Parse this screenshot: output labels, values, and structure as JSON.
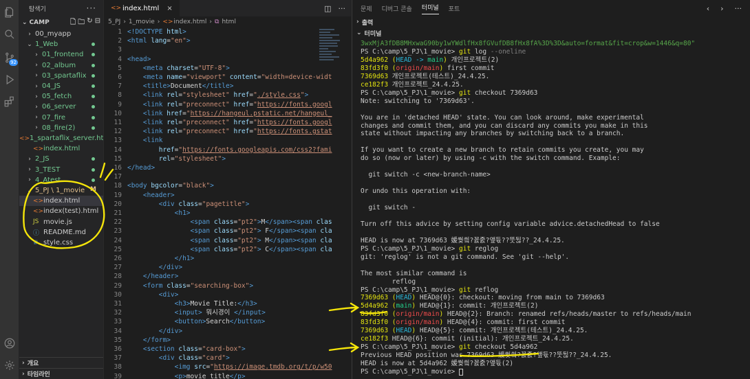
{
  "explorer": {
    "title": "탐색기",
    "root": "CAMP",
    "items": [
      {
        "label": "00_myapp",
        "chev": "›",
        "indent": 1,
        "color": "",
        "mark": ""
      },
      {
        "label": "1_Web",
        "chev": "⌄",
        "indent": 1,
        "color": "green",
        "mark": "dot"
      },
      {
        "label": "01_frontend",
        "chev": "›",
        "indent": 2,
        "color": "green",
        "mark": "dot"
      },
      {
        "label": "02_album",
        "chev": "›",
        "indent": 2,
        "color": "green",
        "mark": "dot"
      },
      {
        "label": "03_spartaflix",
        "chev": "›",
        "indent": 2,
        "color": "green",
        "mark": "dot"
      },
      {
        "label": "04_JS",
        "chev": "›",
        "indent": 2,
        "color": "green",
        "mark": "dot"
      },
      {
        "label": "05_fetch",
        "chev": "›",
        "indent": 2,
        "color": "green",
        "mark": "dot"
      },
      {
        "label": "06_server",
        "chev": "›",
        "indent": 2,
        "color": "green",
        "mark": "dot"
      },
      {
        "label": "07_fire",
        "chev": "›",
        "indent": 2,
        "color": "green",
        "mark": "dot"
      },
      {
        "label": "08_fire(2)",
        "chev": "›",
        "indent": 2,
        "color": "green",
        "mark": "dot"
      },
      {
        "label": "1_spartaflix_server.ht...",
        "chev": "",
        "indent": 2,
        "color": "green",
        "mark": "",
        "icon": "html"
      },
      {
        "label": "index.html",
        "chev": "",
        "indent": 2,
        "color": "green",
        "mark": "",
        "icon": "html"
      },
      {
        "label": "2_JS",
        "chev": "›",
        "indent": 1,
        "color": "green",
        "mark": "dot"
      },
      {
        "label": "3_TEST",
        "chev": "›",
        "indent": 1,
        "color": "green",
        "mark": "dot"
      },
      {
        "label": "4_Atest",
        "chev": "›",
        "indent": 1,
        "color": "green",
        "mark": "dot"
      },
      {
        "label": "5_PJ \\ 1_movie",
        "chev": "⌄",
        "indent": 1,
        "color": "orange",
        "mark": "M"
      },
      {
        "label": "index.html",
        "chev": "",
        "indent": 2,
        "color": "",
        "mark": "",
        "icon": "html",
        "selected": true
      },
      {
        "label": "index(test).html",
        "chev": "",
        "indent": 2,
        "color": "",
        "mark": "",
        "icon": "html"
      },
      {
        "label": "movie.js",
        "chev": "",
        "indent": 2,
        "color": "",
        "mark": "",
        "icon": "js"
      },
      {
        "label": "README.md",
        "chev": "",
        "indent": 2,
        "color": "",
        "mark": "",
        "icon": "md"
      },
      {
        "label": "style.css",
        "chev": "",
        "indent": 2,
        "color": "",
        "mark": "",
        "icon": "css"
      }
    ],
    "bottom": [
      "개요",
      "타임라인"
    ]
  },
  "activity": {
    "scm_badge": "92"
  },
  "editor": {
    "tab": "index.html",
    "breadcrumb": [
      "5_PJ",
      "1_movie",
      "index.html",
      "html"
    ]
  },
  "code": [
    {
      "n": "1",
      "h": "<span class='tg'>&lt;!DOCTYPE</span> <span class='at'>html</span><span class='tg'>&gt;</span>"
    },
    {
      "n": "2",
      "h": "<span class='tg'>&lt;html</span> <span class='at'>lang</span><span class='tx'>=</span><span class='st'>\"en\"</span><span class='tg'>&gt;</span>"
    },
    {
      "n": "3",
      "h": ""
    },
    {
      "n": "4",
      "h": "<span class='tg'>&lt;head&gt;</span>"
    },
    {
      "n": "5",
      "h": "    <span class='tg'>&lt;meta</span> <span class='at'>charset</span><span class='tx'>=</span><span class='st'>\"UTF-8\"</span><span class='tg'>&gt;</span>"
    },
    {
      "n": "6",
      "h": "    <span class='tg'>&lt;meta</span> <span class='at'>name</span><span class='tx'>=</span><span class='st'>\"viewport\"</span> <span class='at'>content</span><span class='tx'>=</span><span class='st'>\"width=device-widt</span>"
    },
    {
      "n": "7",
      "h": "    <span class='tg'>&lt;title&gt;</span><span class='tx'>Document</span><span class='tg'>&lt;/title&gt;</span>"
    },
    {
      "n": "8",
      "h": "    <span class='tg'>&lt;link</span> <span class='at'>rel</span><span class='tx'>=</span><span class='st'>\"stylesheet\"</span> <span class='at'>href</span><span class='tx'>=</span><span class='st'>\"<span class='ul'>./style.css</span>\"</span><span class='tg'>&gt;</span>"
    },
    {
      "n": "9",
      "h": "    <span class='tg'>&lt;link</span> <span class='at'>rel</span><span class='tx'>=</span><span class='st'>\"preconnect\"</span> <span class='at'>href</span><span class='tx'>=</span><span class='st'>\"<span class='ul'>https://fonts.googl</span></span>"
    },
    {
      "n": "10",
      "h": "    <span class='tg'>&lt;link</span> <span class='at'>href</span><span class='tx'>=</span><span class='st'>\"<span class='ul'>https://hangeul.pstatic.net/hangeul_</span></span>"
    },
    {
      "n": "11",
      "h": "    <span class='tg'>&lt;link</span> <span class='at'>rel</span><span class='tx'>=</span><span class='st'>\"preconnect\"</span> <span class='at'>href</span><span class='tx'>=</span><span class='st'>\"<span class='ul'>https://fonts.googl</span></span>"
    },
    {
      "n": "12",
      "h": "    <span class='tg'>&lt;link</span> <span class='at'>rel</span><span class='tx'>=</span><span class='st'>\"preconnect\"</span> <span class='at'>href</span><span class='tx'>=</span><span class='st'>\"<span class='ul'>https://fonts.gstat</span></span>"
    },
    {
      "n": "13",
      "h": "    <span class='tg'>&lt;link</span>"
    },
    {
      "n": "14",
      "h": "        <span class='at'>href</span><span class='tx'>=</span><span class='st'>\"<span class='ul'>https://fonts.googleapis.com/css2?fami</span></span>"
    },
    {
      "n": "15",
      "h": "        <span class='at'>rel</span><span class='tx'>=</span><span class='st'>\"stylesheet\"</span><span class='tg'>&gt;</span>"
    },
    {
      "n": "16",
      "h": "<span class='tg'>&lt;/head&gt;</span>"
    },
    {
      "n": "17",
      "h": ""
    },
    {
      "n": "18",
      "h": "<span class='tg'>&lt;body</span> <span class='at'>bgcolor</span><span class='tx'>=</span><span class='st'>\"black\"</span><span class='tg'>&gt;</span>"
    },
    {
      "n": "19",
      "h": "    <span class='tg'>&lt;header&gt;</span>"
    },
    {
      "n": "20",
      "h": "        <span class='tg'>&lt;div</span> <span class='at'>class</span><span class='tx'>=</span><span class='st'>\"pagetitle\"</span><span class='tg'>&gt;</span>"
    },
    {
      "n": "21",
      "h": "            <span class='tg'>&lt;h1&gt;</span>"
    },
    {
      "n": "22",
      "h": "                <span class='tg'>&lt;span</span> <span class='at'>class</span><span class='tx'>=</span><span class='st'>\"pt2\"</span><span class='tg'>&gt;</span><span class='tx'>M</span><span class='tg'>&lt;/span&gt;&lt;span</span> <span class='at'>clas</span>"
    },
    {
      "n": "23",
      "h": "                <span class='tg'>&lt;span</span> <span class='at'>class</span><span class='tx'>=</span><span class='st'>\"pt2\"</span><span class='tg'>&gt;</span><span class='tx'> F</span><span class='tg'>&lt;/span&gt;&lt;span</span> <span class='at'>cla</span>"
    },
    {
      "n": "24",
      "h": "                <span class='tg'>&lt;span</span> <span class='at'>class</span><span class='tx'>=</span><span class='st'>\"pt2\"</span><span class='tg'>&gt;</span><span class='tx'> M</span><span class='tg'>&lt;/span&gt;&lt;span</span> <span class='at'>cla</span>"
    },
    {
      "n": "25",
      "h": "                <span class='tg'>&lt;span</span> <span class='at'>class</span><span class='tx'>=</span><span class='st'>\"pt2\"</span><span class='tg'>&gt;</span><span class='tx'> C</span><span class='tg'>&lt;/span&gt;&lt;span</span> <span class='at'>cla</span>"
    },
    {
      "n": "26",
      "h": "            <span class='tg'>&lt;/h1&gt;</span>"
    },
    {
      "n": "27",
      "h": "        <span class='tg'>&lt;/div&gt;</span>"
    },
    {
      "n": "28",
      "h": "    <span class='tg'>&lt;/header&gt;</span>"
    },
    {
      "n": "29",
      "h": "    <span class='tg'>&lt;form</span> <span class='at'>class</span><span class='tx'>=</span><span class='st'>\"searching-box\"</span><span class='tg'>&gt;</span>"
    },
    {
      "n": "30",
      "h": "        <span class='tg'>&lt;div&gt;</span>"
    },
    {
      "n": "31",
      "h": "            <span class='tg'>&lt;h3&gt;</span><span class='tx'>Movie Title:</span><span class='tg'>&lt;/h3&gt;</span>"
    },
    {
      "n": "32",
      "h": "            <span class='tg'>&lt;input&gt;</span><span class='tx'> 뭐시경이 </span><span class='tg'>&lt;/input&gt;</span>"
    },
    {
      "n": "33",
      "h": "            <span class='tg'>&lt;button&gt;</span><span class='tx'>Search</span><span class='tg'>&lt;/button&gt;</span>"
    },
    {
      "n": "34",
      "h": "        <span class='tg'>&lt;/div&gt;</span>"
    },
    {
      "n": "35",
      "h": "    <span class='tg'>&lt;/form&gt;</span>"
    },
    {
      "n": "36",
      "h": "    <span class='tg'>&lt;section</span> <span class='at'>class</span><span class='tx'>=</span><span class='st'>\"card-box\"</span><span class='tg'>&gt;</span>"
    },
    {
      "n": "37",
      "h": "        <span class='tg'>&lt;div</span> <span class='at'>class</span><span class='tx'>=</span><span class='st'>\"card\"</span><span class='tg'>&gt;</span>"
    },
    {
      "n": "38",
      "h": "            <span class='tg'>&lt;img</span> <span class='at'>src</span><span class='tx'>=</span><span class='st'>\"<span class='ul'>https://image.tmdb.org/t/p/w50</span></span>"
    },
    {
      "n": "39",
      "h": "            <span class='tg'>&lt;p&gt;</span><span class='tx'>movie title</span><span class='tg'>&lt;/p&gt;</span>"
    }
  ],
  "panel": {
    "tabs": [
      "문제",
      "디버그 콘솔",
      "터미널",
      "포트"
    ],
    "active_tab": "터미널",
    "sections": [
      "출력",
      "터미널"
    ]
  },
  "terminal": [
    {
      "h": "<span class='lg'>3wxMjA3fDB8MHxwaG90by1wYWdlfHx8fGVufDB8fHx8fA%3D%3D&amp;auto=format&amp;fit=crop&amp;w=1446&amp;q=80\"</span>"
    },
    {
      "h": "PS C:\\camp\\5_PJ\\1_movie&gt; <span class='yl'>git</span> log <span class='pu'>--oneline</span>"
    },
    {
      "h": "<span class='yl'>5d4a962</span> <span class='yl'>(</span><span class='cy'>HEAD -&gt; </span><span class='gr'>main</span><span class='yl'>)</span> 개인프로젝트(2)"
    },
    {
      "h": "<span class='yl'>83fd3f0</span> <span class='yl'>(</span><span class='rd'>origin/main</span><span class='yl'>)</span> first commit"
    },
    {
      "h": "<span class='yl'>7369d63</span> 개인프로젝트(테스트)_24.4.25."
    },
    {
      "h": "<span class='yl'>ce182f3</span> 개인프로젝트_24.4.25."
    },
    {
      "h": "PS C:\\camp\\5_PJ\\1_movie&gt; <span class='yl'>git</span> checkout 7369d63"
    },
    {
      "h": "Note: switching to '7369d63'."
    },
    {
      "h": ""
    },
    {
      "h": "You are in 'detached HEAD' state. You can look around, make experimental"
    },
    {
      "h": "changes and commit them, and you can discard any commits you make in this"
    },
    {
      "h": "state without impacting any branches by switching back to a branch."
    },
    {
      "h": ""
    },
    {
      "h": "If you want to create a new branch to retain commits you create, you may"
    },
    {
      "h": "do so (now or later) by using -c with the switch command. Example:"
    },
    {
      "h": ""
    },
    {
      "h": "  git switch -c &lt;new-branch-name&gt;"
    },
    {
      "h": ""
    },
    {
      "h": "Or undo this operation with:"
    },
    {
      "h": ""
    },
    {
      "h": "  git switch -"
    },
    {
      "h": ""
    },
    {
      "h": "Turn off this advice by setting config variable advice.detachedHead to false"
    },
    {
      "h": ""
    },
    {
      "h": "HEAD is now at 7369d63 媛쒖씤?꾨줈?앺듃??뚯뒪??_24.4.25."
    },
    {
      "h": "PS C:\\camp\\5_PJ\\1_movie&gt; <span class='yl'>git</span> reglog"
    },
    {
      "h": "git: 'reglog' is not a git command. See 'git --help'."
    },
    {
      "h": ""
    },
    {
      "h": "The most similar command is"
    },
    {
      "h": "        reflog"
    },
    {
      "h": "PS C:\\camp\\5_PJ\\1_movie&gt; <span class='yl'>git</span> reflog"
    },
    {
      "h": "<span class='yl'>7369d63</span> <span class='yl'>(</span><span class='cy'>HEAD</span><span class='yl'>)</span> HEAD@{0}: checkout: moving from main to 7369d63"
    },
    {
      "h": "<span class='yl'>5d4a962</span> <span class='yl'>(</span><span class='gr'>main</span><span class='yl'>)</span> HEAD@{1}: commit: 개인프로젝트(2)"
    },
    {
      "h": "<span class='yl'>83fd3f0</span> <span class='yl'>(</span><span class='rd'>origin/main</span><span class='yl'>)</span> HEAD@{2}: Branch: renamed refs/heads/master to refs/heads/main"
    },
    {
      "h": "<span class='yl'>83fd3f0</span> <span class='yl'>(</span><span class='rd'>origin/main</span><span class='yl'>)</span> HEAD@{4}: commit: first commit"
    },
    {
      "h": "<span class='yl'>7369d63</span> <span class='yl'>(</span><span class='cy'>HEAD</span><span class='yl'>)</span> HEAD@{5}: commit: 개인프로젝트(테스트)_24.4.25."
    },
    {
      "h": "<span class='yl'>ce182f3</span> HEAD@{6}: commit (initial): 개인프로젝트_24.4.25."
    },
    {
      "h": "PS C:\\camp\\5_PJ\\1_movie&gt; <span class='yl'>git</span> checkout 5d4a962"
    },
    {
      "h": "Previous HEAD position was 7369d63 媛쒖씤?꾨줈?앺듃??뚯뒪??_24.4.25."
    },
    {
      "h": "HEAD is now at 5d4a962 媛쒖씤?꾨줈?앺듃(2)"
    },
    {
      "h": "PS C:\\camp\\5_PJ\\1_movie&gt; <span class='cursor'></span>"
    }
  ],
  "colors": {
    "accent": "#007acc",
    "annotation": "#f5e50a"
  }
}
